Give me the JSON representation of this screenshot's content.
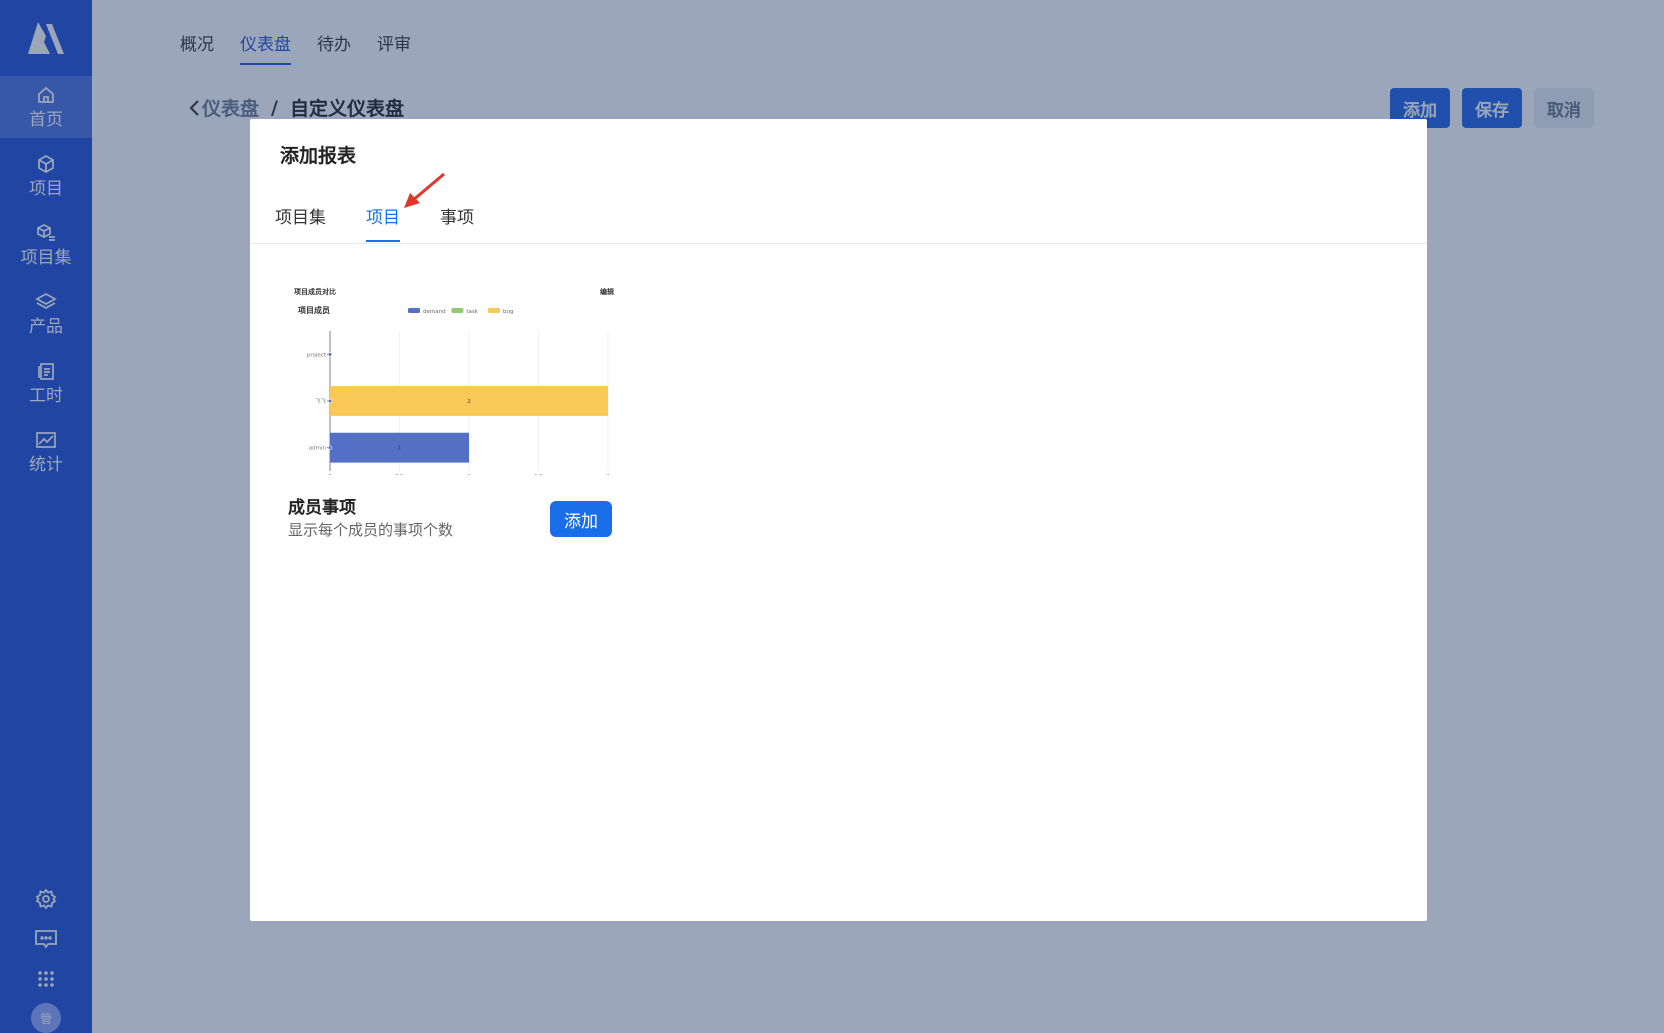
{
  "sidebar": {
    "items": [
      {
        "label": "首页",
        "icon": "home-icon",
        "active": true
      },
      {
        "label": "项目",
        "icon": "box-icon"
      },
      {
        "label": "项目集",
        "icon": "box-list-icon"
      },
      {
        "label": "产品",
        "icon": "layers-icon"
      },
      {
        "label": "工时",
        "icon": "document-icon"
      },
      {
        "label": "统计",
        "icon": "image-chart-icon"
      }
    ],
    "avatar_text": "管"
  },
  "top_tabs": [
    {
      "label": "概况"
    },
    {
      "label": "仪表盘",
      "active": true
    },
    {
      "label": "待办"
    },
    {
      "label": "评审"
    }
  ],
  "breadcrumb": {
    "parent": "仪表盘",
    "separator": "/",
    "current": "自定义仪表盘"
  },
  "toolbar": {
    "add_label": "添加",
    "save_label": "保存",
    "cancel_label": "取消"
  },
  "modal": {
    "title": "添加报表",
    "tabs": [
      {
        "label": "项目集"
      },
      {
        "label": "项目",
        "active": true
      },
      {
        "label": "事项"
      }
    ],
    "cards": [
      {
        "title": "成员事项",
        "description": "显示每个成员的事项个数",
        "add_label": "添加"
      }
    ]
  },
  "chart_data": {
    "type": "bar",
    "orientation": "horizontal",
    "title": "项目成员对比",
    "subtitle": "项目成员",
    "edit_label": "编辑",
    "categories": [
      "project",
      "飞飞",
      "admin"
    ],
    "series": [
      {
        "name": "demand",
        "color": "#5470c6",
        "values": [
          0,
          0,
          1
        ]
      },
      {
        "name": "task",
        "color": "#91cc75",
        "values": [
          0,
          0,
          0
        ]
      },
      {
        "name": "bug",
        "color": "#fac858",
        "values": [
          0,
          2,
          0
        ]
      }
    ],
    "bar_labels": {
      "飞飞": "2",
      "admin": "1"
    },
    "xlim": [
      0,
      2
    ],
    "x_ticks": [
      "0",
      "0.5",
      "1",
      "1.5",
      "2"
    ],
    "legend": "top",
    "grid": true
  }
}
